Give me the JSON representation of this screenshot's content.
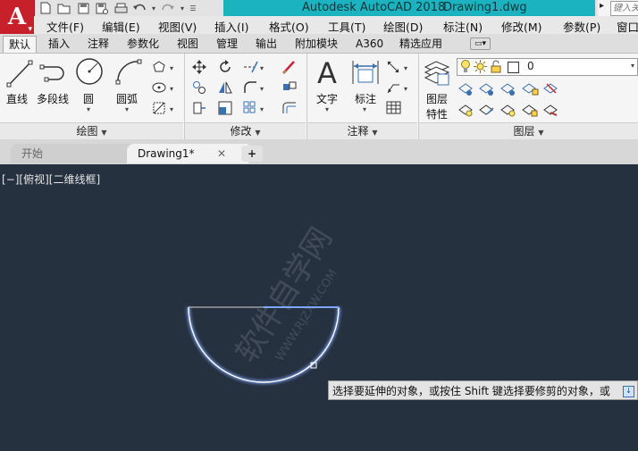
{
  "window": {
    "title_app": "Autodesk AutoCAD 2018",
    "title_file": "Drawing1.dwg",
    "search_placeholder": "键入关",
    "logo_letter": "A"
  },
  "menubar": [
    "文件(F)",
    "编辑(E)",
    "视图(V)",
    "插入(I)",
    "格式(O)",
    "工具(T)",
    "绘图(D)",
    "标注(N)",
    "修改(M)",
    "参数(P)",
    "窗口"
  ],
  "ribbon_tabs": [
    "默认",
    "插入",
    "注释",
    "参数化",
    "视图",
    "管理",
    "输出",
    "附加模块",
    "A360",
    "精选应用"
  ],
  "active_tab": "默认",
  "ribbon": {
    "draw": {
      "line": "直线",
      "polyline": "多段线",
      "circle": "圆",
      "arc": "圆弧",
      "footer": "绘图"
    },
    "modify": {
      "footer": "修改"
    },
    "annotation": {
      "text": "文字",
      "dimension": "标注",
      "footer": "注释"
    },
    "layers": {
      "properties_line1": "图层",
      "properties_line2": "特性",
      "current_layer": "0",
      "footer": "图层"
    }
  },
  "file_tabs": {
    "start": "开始",
    "drawing": "Drawing1*"
  },
  "viewport": {
    "label": "[−][俯视][二维线框]"
  },
  "command_prompt": "选择要延伸的对象，或按住 Shift 键选择要修剪的对象，或",
  "colors": {
    "canvas": "#263140",
    "title_accent": "#1ab3bf",
    "logo": "#c8202a",
    "selection_glow": "#7fa6ff"
  }
}
